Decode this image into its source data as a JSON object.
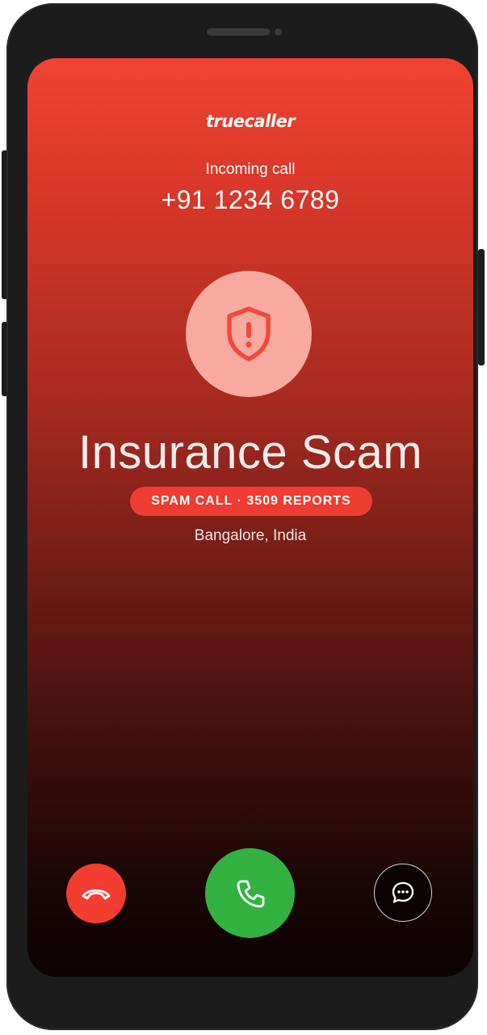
{
  "app": {
    "brand": "truecaller"
  },
  "call": {
    "status": "Incoming call",
    "number": "+91 1234 6789",
    "caller_name": "Insurance Scam",
    "spam_label": "SPAM CALL · 3509 REPORTS",
    "location": "Bangalore, India"
  },
  "icons": {
    "avatar": "shield-alert-icon",
    "swipe": "chevron-up-icon",
    "decline": "phone-hangup-icon",
    "accept": "phone-icon",
    "message": "message-bubble-icon"
  },
  "colors": {
    "header_red": "#f24332",
    "badge_red": "#ef3d31",
    "avatar_bg": "#f8a9a0",
    "accept_green": "#33b241",
    "decline_red": "#f33d31"
  }
}
